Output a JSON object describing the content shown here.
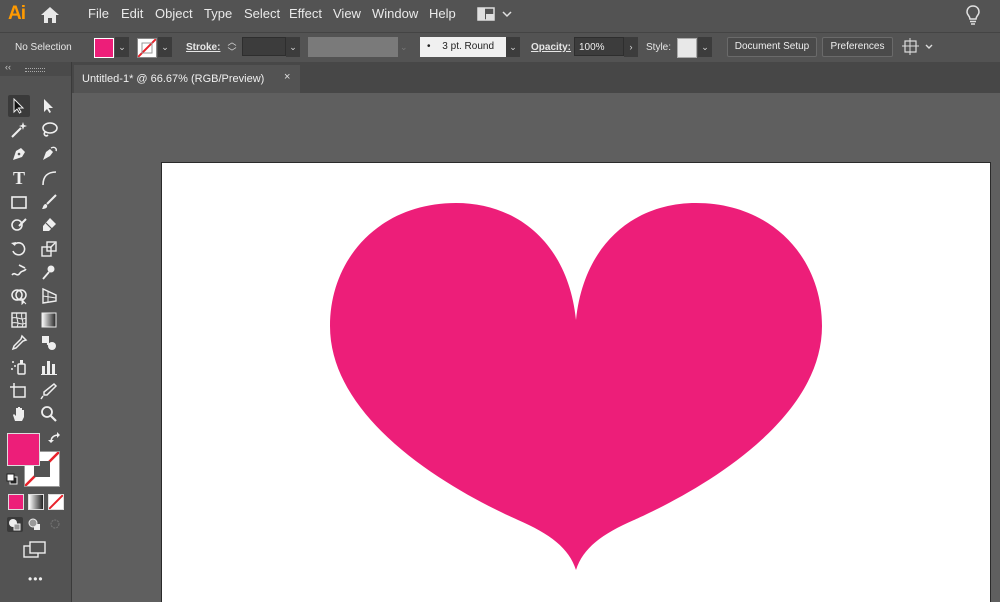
{
  "app": {
    "logo": "Ai"
  },
  "menu": [
    "File",
    "Edit",
    "Object",
    "Type",
    "Select",
    "Effect",
    "View",
    "Window",
    "Help"
  ],
  "control_bar": {
    "selection": "No Selection",
    "stroke_label": "Stroke:",
    "brush_label": "3 pt. Round",
    "brush_dot": "•",
    "opacity_label": "Opacity:",
    "opacity_value": "100%",
    "style_label": "Style:",
    "document_setup": "Document Setup",
    "preferences": "Preferences"
  },
  "tab": {
    "title": "Untitled-1* @ 66.67% (RGB/Preview)",
    "close": "×"
  },
  "colors": {
    "fill": "#ed1e79",
    "heart": "#ed1e79",
    "ui_bg": "#535353",
    "canvas_bg": "#5f5f5f",
    "artboard": "#ffffff",
    "logo": "#ff9a00"
  },
  "icons": [
    "home-icon",
    "workspace-switcher-icon",
    "lightbulb-icon",
    "selection-tool-icon",
    "direct-selection-tool-icon",
    "magic-wand-tool-icon",
    "lasso-tool-icon",
    "pen-tool-icon",
    "curvature-tool-icon",
    "type-tool-icon",
    "line-tool-icon",
    "rectangle-tool-icon",
    "paintbrush-tool-icon",
    "shaper-tool-icon",
    "eraser-tool-icon",
    "rotate-tool-icon",
    "scale-tool-icon",
    "warp-tool-icon",
    "puppet-warp-tool-icon",
    "shape-builder-tool-icon",
    "perspective-grid-tool-icon",
    "mesh-tool-icon",
    "gradient-tool-icon",
    "eyedropper-tool-icon",
    "blend-tool-icon",
    "symbol-sprayer-tool-icon",
    "column-graph-tool-icon",
    "artboard-tool-icon",
    "slice-tool-icon",
    "hand-tool-icon",
    "zoom-tool-icon",
    "swap-colors-icon",
    "default-colors-icon",
    "color-mode-icon",
    "gradient-mode-icon",
    "none-mode-icon",
    "draw-normal-icon",
    "draw-behind-icon",
    "draw-inside-icon",
    "screen-mode-icon",
    "edit-toolbar-icon"
  ],
  "toolbar": {
    "more": "•••",
    "collapse": "‹‹"
  }
}
